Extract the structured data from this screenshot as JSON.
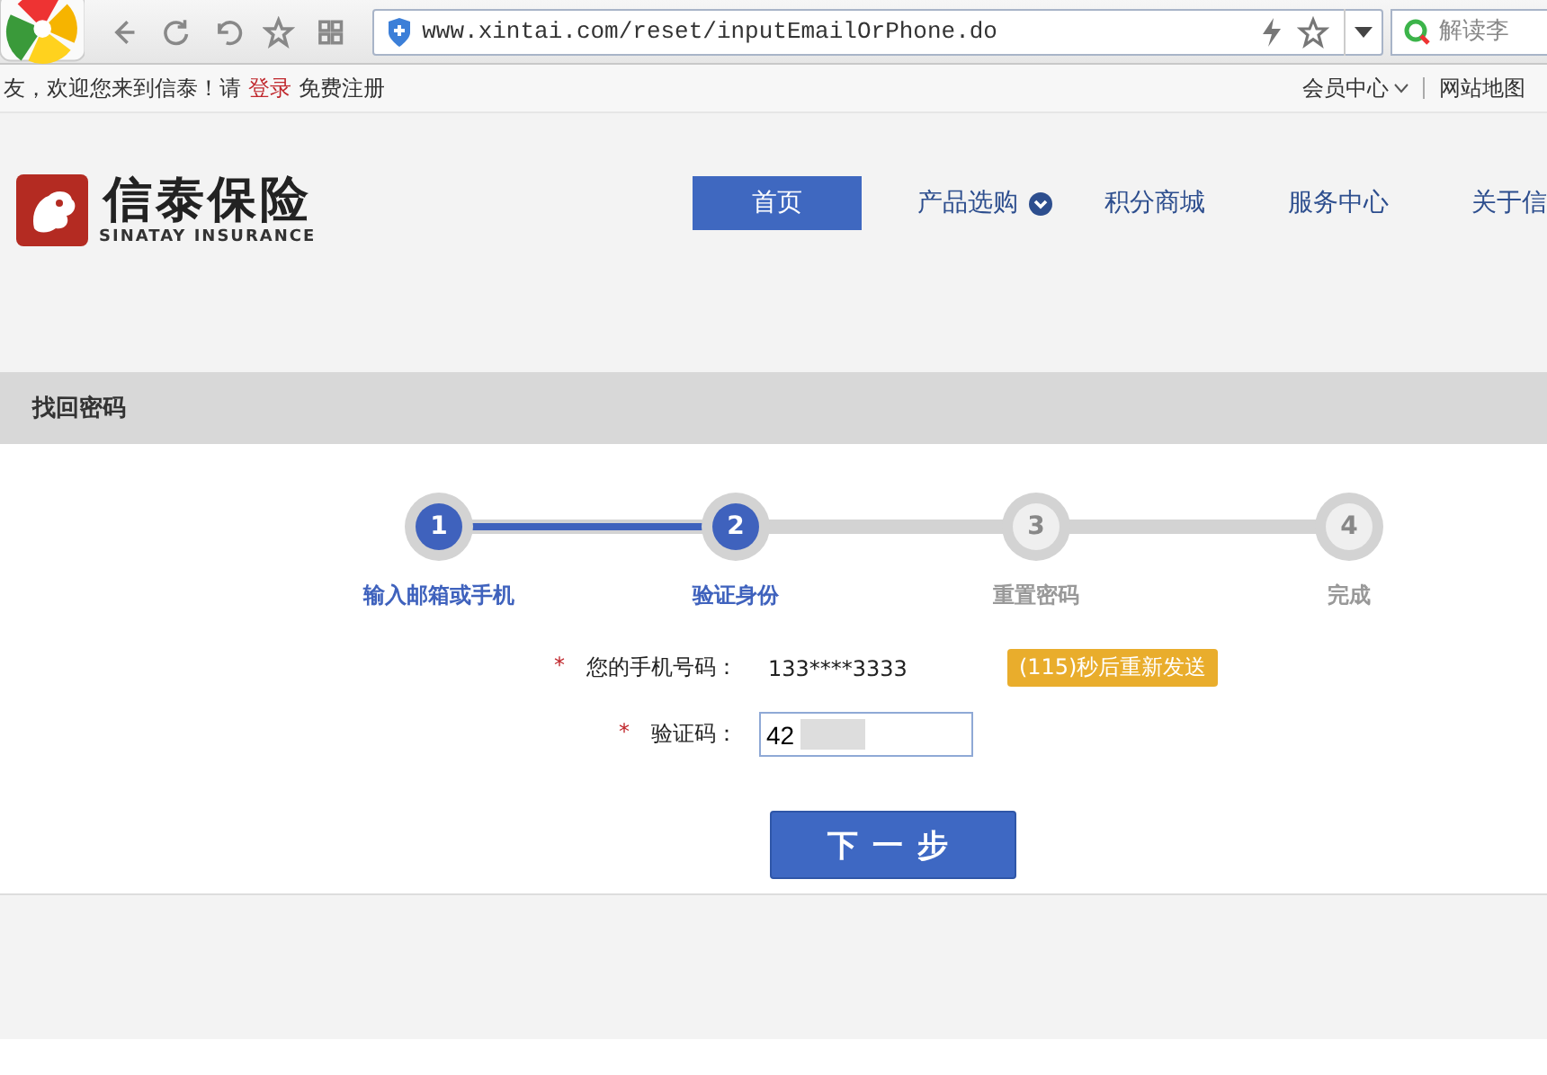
{
  "browser": {
    "url": "www.xintai.com/reset/inputEmailOrPhone.do",
    "search": {
      "placeholder": "解读李"
    }
  },
  "top_bar": {
    "welcome": "友，欢迎您来到信泰！请",
    "login": "登录",
    "register": "免费注册",
    "links": [
      {
        "label": "会员中心",
        "dropdown": true
      },
      {
        "label": "网站地图",
        "dropdown": false
      }
    ]
  },
  "logo": {
    "name": "信泰保险",
    "subtitle": "SINATAY INSURANCE"
  },
  "nav": [
    {
      "label": "首页",
      "selected": true,
      "dropdown": false
    },
    {
      "label": "产品选购",
      "selected": false,
      "dropdown": true
    },
    {
      "label": "积分商城",
      "selected": false,
      "dropdown": false
    },
    {
      "label": "服务中心",
      "selected": false,
      "dropdown": false
    },
    {
      "label": "关于信",
      "selected": false,
      "dropdown": false
    }
  ],
  "section_title": "找回密码",
  "steps": [
    {
      "number": "1",
      "label": "输入邮箱或手机",
      "active": true
    },
    {
      "number": "2",
      "label": "验证身份",
      "active": true
    },
    {
      "number": "3",
      "label": "重置密码",
      "active": false
    },
    {
      "number": "4",
      "label": "完成",
      "active": false
    }
  ],
  "form": {
    "phone": {
      "mark": "*",
      "label": "您的手机号码：",
      "value": "133****3333",
      "resend_button": "(115)秒后重新发送"
    },
    "code": {
      "mark": "*",
      "label": "验证码：",
      "value": "42"
    },
    "next_button": "下一步"
  }
}
